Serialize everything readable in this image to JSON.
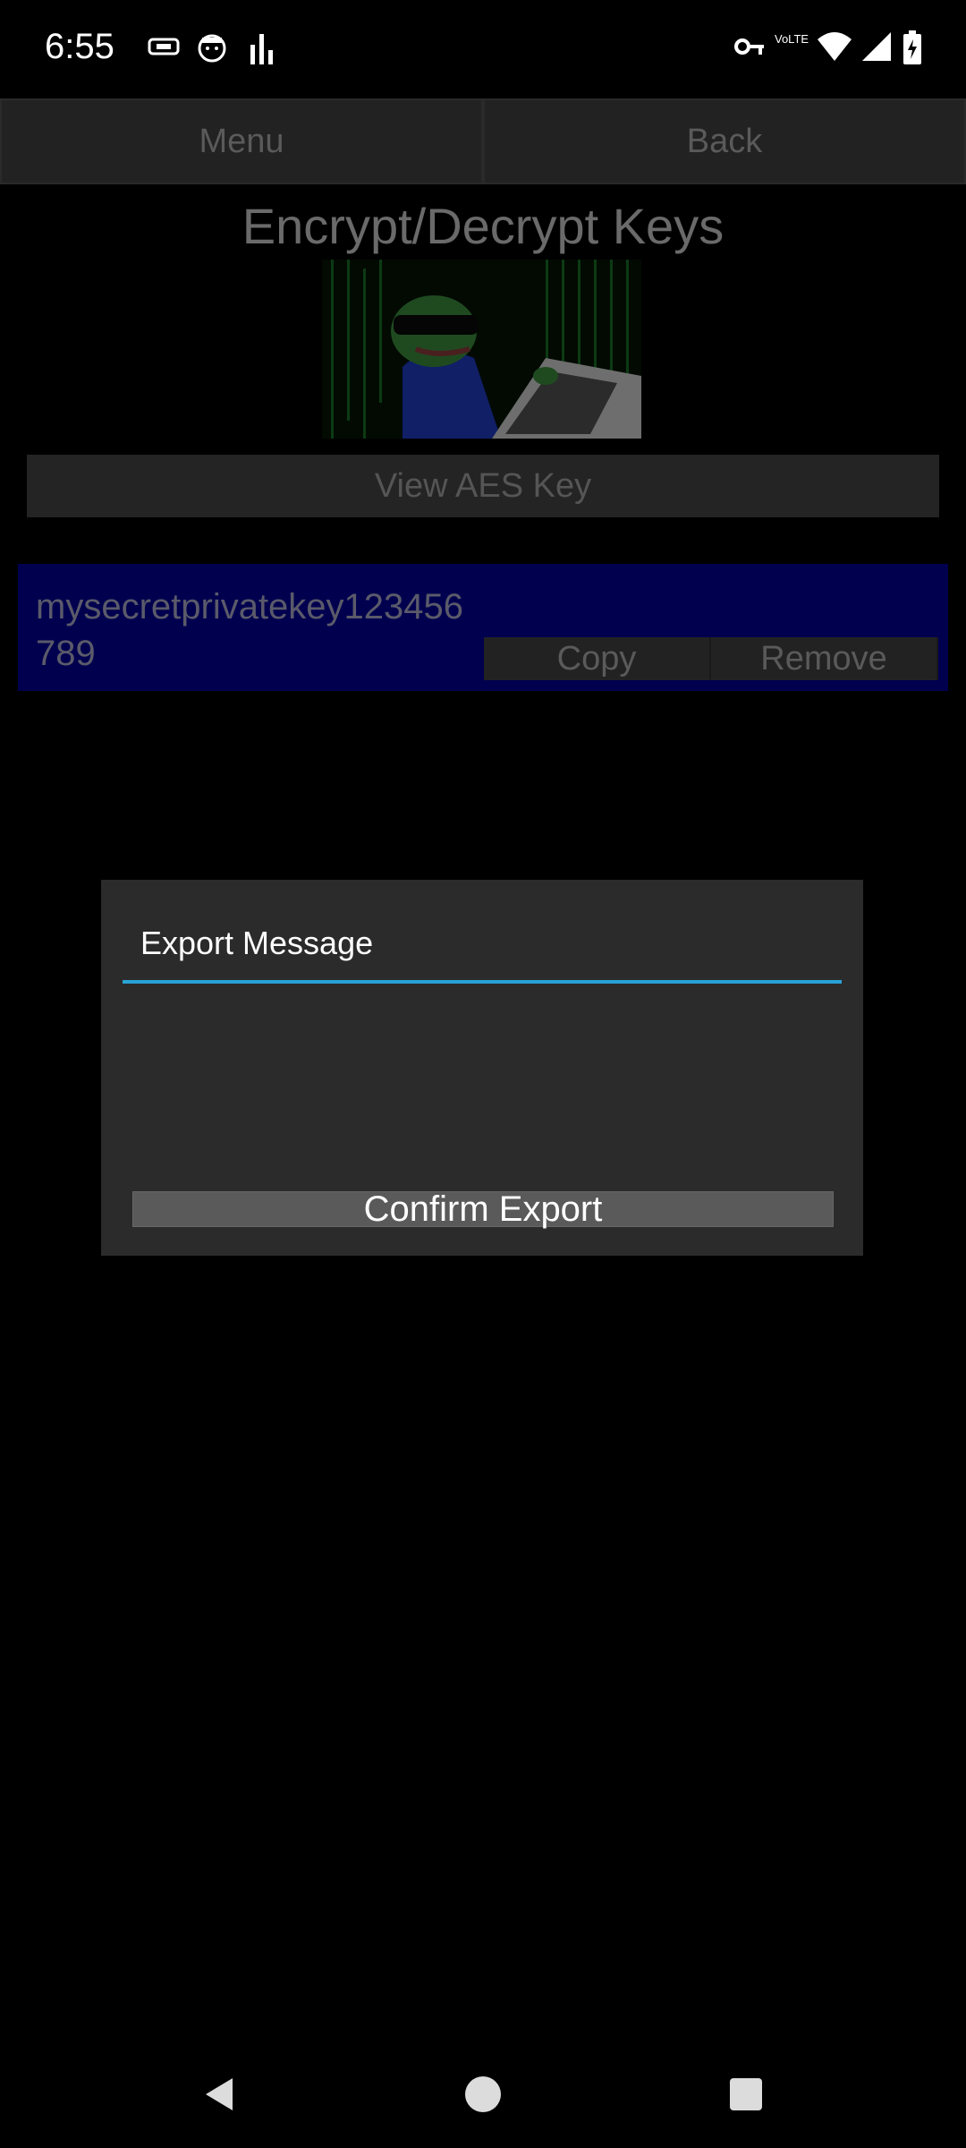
{
  "status_bar": {
    "time": "6:55",
    "left_icons": [
      "cast-icon",
      "android-face-icon",
      "signal-bars-icon"
    ],
    "right_icons": [
      "key-icon",
      "volte-icon",
      "wifi-icon",
      "cell-signal-icon",
      "battery-icon"
    ],
    "volte_label": "VoLTE"
  },
  "toolbar": {
    "menu_label": "Menu",
    "back_label": "Back"
  },
  "page": {
    "title": "Encrypt/Decrypt Keys",
    "view_aes_label": "View AES Key"
  },
  "key_entry": {
    "text": "mysecretprivatekey123456789",
    "copy_label": "Copy",
    "remove_label": "Remove"
  },
  "dialog": {
    "placeholder": "Export Message",
    "confirm_label": "Confirm Export",
    "accent_color": "#29a3d6"
  },
  "colors": {
    "background": "#000000",
    "dialog_bg": "#2b2b2b",
    "key_card_bg": "#00004f"
  }
}
